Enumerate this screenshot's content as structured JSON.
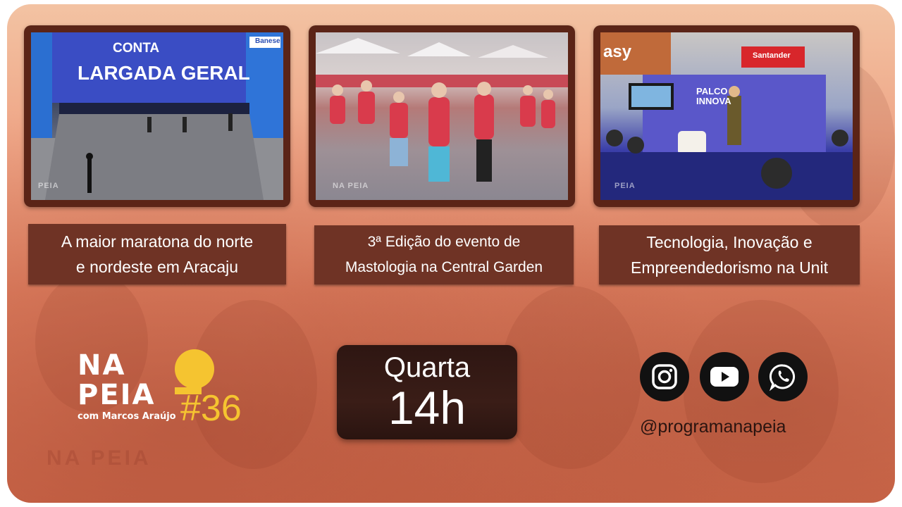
{
  "events": [
    {
      "caption_line1": "A maior maratona do norte",
      "caption_line2": "e nordeste em Aracaju",
      "photo_text_1": "CONTA",
      "photo_text_2": "LARGADA GERAL",
      "photo_sponsor": "Banese",
      "watermark": "PEIA"
    },
    {
      "caption_line1": "3ª Edição do evento de",
      "caption_line2": "Mastologia na Central Garden",
      "watermark": "NA PEIA"
    },
    {
      "caption_line1": "Tecnologia, Inovação e",
      "caption_line2": "Empreendedorismo na Unit",
      "photo_text_1": "PALCO",
      "photo_text_2": "INNOVA",
      "photo_sponsor": "Santander",
      "photo_brand": "asy",
      "watermark": "PEIA"
    }
  ],
  "logo": {
    "line1": "NA",
    "line2": "PEIA",
    "host": "com Marcos Araújo",
    "episode": "#36",
    "ghost": "NA PEIA",
    "accent_color": "#f5c430"
  },
  "schedule": {
    "day": "Quarta",
    "time": "14h"
  },
  "social": {
    "handle": "@programanapeia",
    "icons": [
      "instagram-icon",
      "youtube-icon",
      "whatsapp-icon"
    ]
  }
}
